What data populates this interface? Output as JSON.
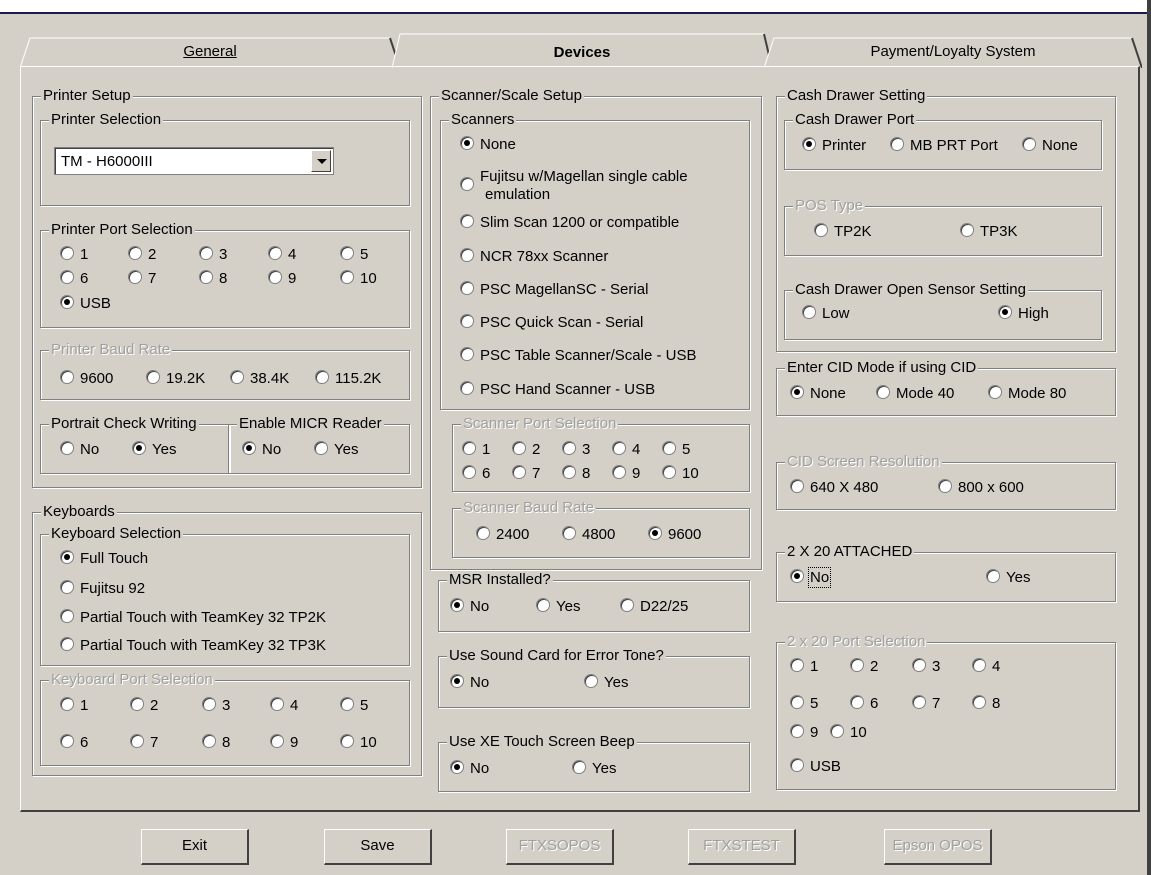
{
  "tabs": [
    {
      "label": "General"
    },
    {
      "label": "Devices"
    },
    {
      "label": "Payment/Loyalty System"
    }
  ],
  "printer_setup": {
    "title": "Printer Setup",
    "selection_title": "Printer Selection",
    "selected_printer": "TM - H6000III",
    "port_title": "Printer Port Selection",
    "ports": [
      "1",
      "2",
      "3",
      "4",
      "5",
      "6",
      "7",
      "8",
      "9",
      "10",
      "USB"
    ],
    "port_selected": "USB",
    "baud_title": "Printer Baud Rate",
    "bauds": [
      "9600",
      "19.2K",
      "38.4K",
      "115.2K"
    ],
    "portrait_title": "Portrait Check Writing",
    "portrait_no": "No",
    "portrait_yes": "Yes",
    "micr_title": "Enable MICR Reader",
    "micr_no": "No",
    "micr_yes": "Yes"
  },
  "keyboards": {
    "title": "Keyboards",
    "selection_title": "Keyboard Selection",
    "options": [
      "Full Touch",
      "Fujitsu 92",
      "Partial Touch with TeamKey 32 TP2K",
      "Partial Touch with TeamKey 32 TP3K"
    ],
    "selected": "Full Touch",
    "port_title": "Keyboard Port Selection",
    "ports": [
      "1",
      "2",
      "3",
      "4",
      "5",
      "6",
      "7",
      "8",
      "9",
      "10"
    ]
  },
  "scanner": {
    "title": "Scanner/Scale Setup",
    "scanners_title": "Scanners",
    "options": [
      "None",
      "Fujitsu w/Magellan single cable",
      "emulation",
      "Slim Scan 1200 or compatible",
      "NCR 78xx Scanner",
      "PSC MagellanSC - Serial",
      "PSC Quick Scan - Serial",
      "PSC Table Scanner/Scale - USB",
      "PSC Hand Scanner - USB"
    ],
    "selected": "None",
    "port_title": "Scanner Port Selection",
    "ports": [
      "1",
      "2",
      "3",
      "4",
      "5",
      "6",
      "7",
      "8",
      "9",
      "10"
    ],
    "baud_title": "Scanner Baud Rate",
    "bauds": [
      "2400",
      "4800",
      "9600"
    ],
    "baud_selected": "9600"
  },
  "msr": {
    "title": "MSR Installed?",
    "no": "No",
    "yes": "Yes",
    "d22": "D22/25"
  },
  "sound": {
    "title": "Use Sound Card for Error Tone?",
    "no": "No",
    "yes": "Yes"
  },
  "beep": {
    "title": "Use XE Touch Screen Beep",
    "no": "No",
    "yes": "Yes"
  },
  "cash_drawer": {
    "title": "Cash Drawer Setting",
    "port_title": "Cash Drawer Port",
    "printer": "Printer",
    "mb": "MB PRT Port",
    "none": "None",
    "pos_title": "POS Type",
    "tp2k": "TP2K",
    "tp3k": "TP3K",
    "sensor_title": "Cash Drawer Open Sensor Setting",
    "low": "Low",
    "high": "High"
  },
  "cid_mode": {
    "title": "Enter CID Mode if using CID",
    "none": "None",
    "m40": "Mode 40",
    "m80": "Mode 80"
  },
  "cid_res": {
    "title": "CID Screen Resolution",
    "r640": "640 X 480",
    "r800": "800  x 600"
  },
  "attached": {
    "title": "2 X 20 ATTACHED",
    "no": "No",
    "yes": "Yes"
  },
  "port220": {
    "title": "2 x 20 Port Selection",
    "ports": [
      "1",
      "2",
      "3",
      "4",
      "5",
      "6",
      "7",
      "8",
      "9",
      "10",
      "USB"
    ]
  },
  "buttons": {
    "exit": "Exit",
    "save": "Save",
    "ftxsopos": "FTXSOPOS",
    "ftxstest": "FTXSTEST",
    "epson": "Epson OPOS"
  }
}
